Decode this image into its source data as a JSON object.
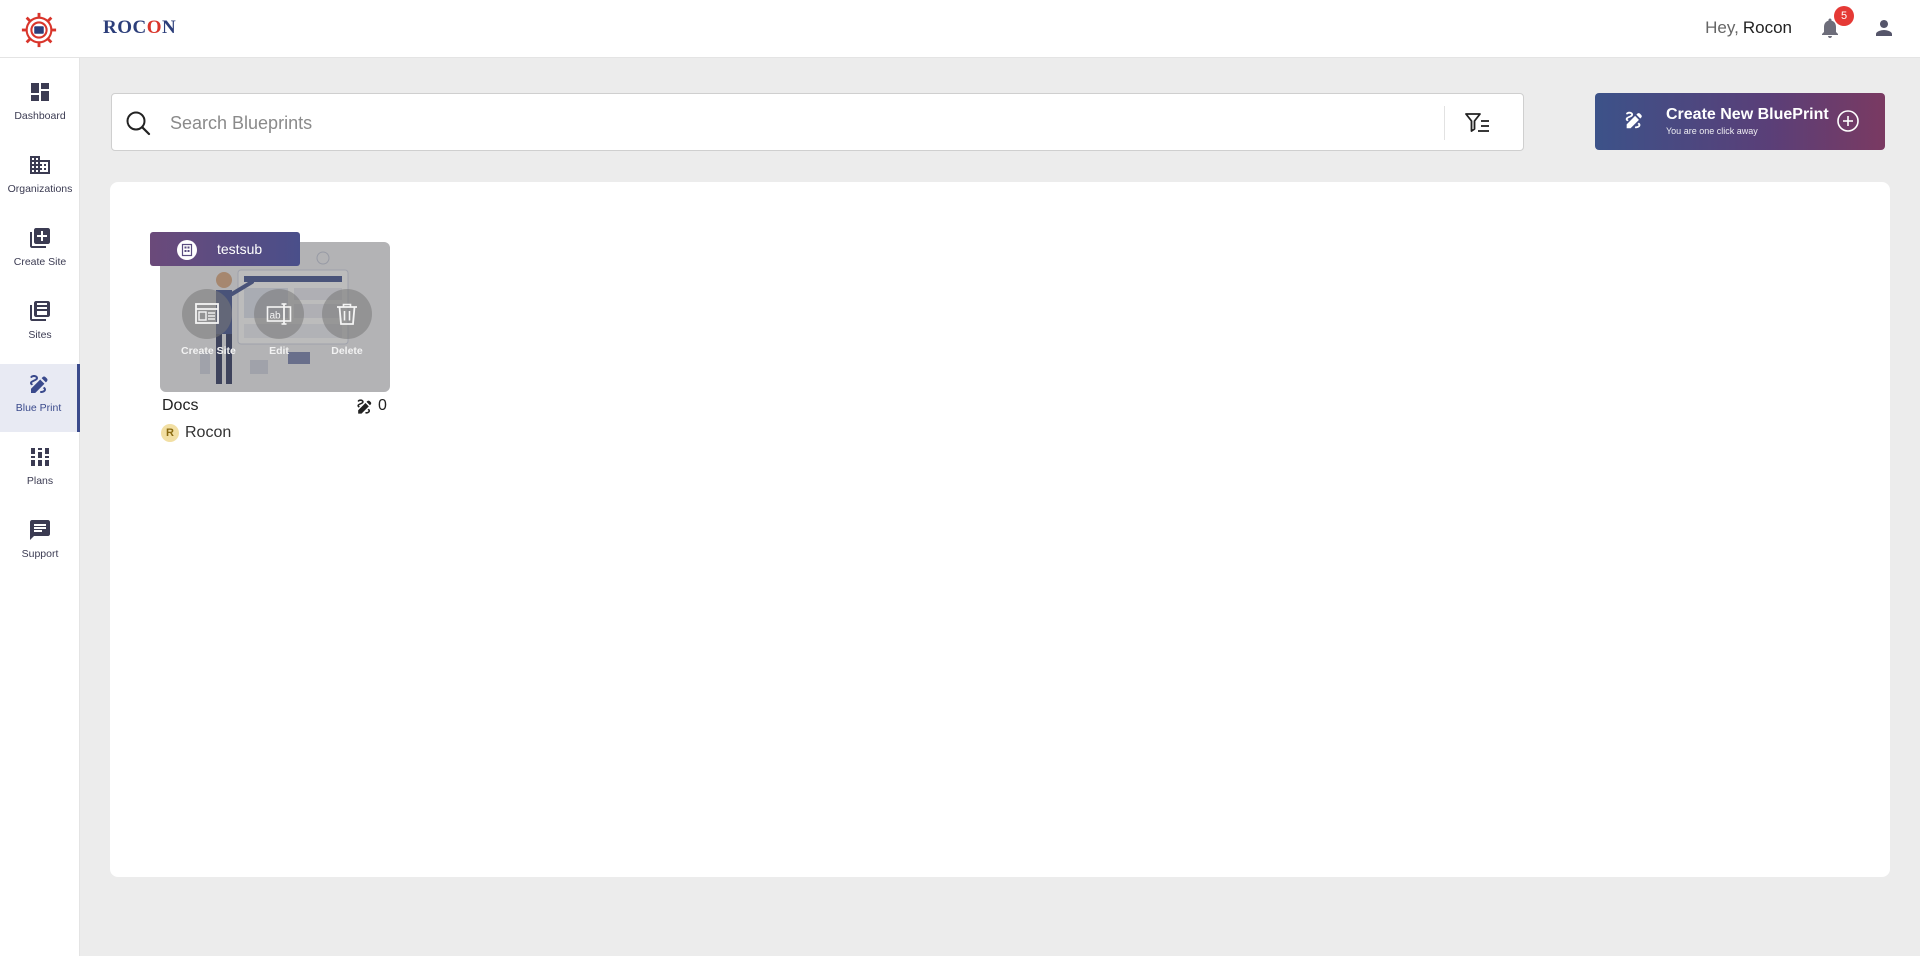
{
  "header": {
    "brand": {
      "prefix": "ROC",
      "accent": "O",
      "suffix": "N"
    },
    "greeting": "Hey,",
    "user_name": "Rocon",
    "notification_count": "5"
  },
  "sidebar": {
    "items": [
      {
        "label": "Dashboard",
        "icon": "dashboard-icon"
      },
      {
        "label": "Organizations",
        "icon": "organizations-icon"
      },
      {
        "label": "Create Site",
        "icon": "add-box-icon"
      },
      {
        "label": "Sites",
        "icon": "sites-icon"
      },
      {
        "label": "Blue Print",
        "icon": "blueprint-icon",
        "active": true
      },
      {
        "label": "Plans",
        "icon": "plans-icon"
      },
      {
        "label": "Support",
        "icon": "support-icon"
      }
    ]
  },
  "search": {
    "placeholder": "Search Blueprints",
    "value": ""
  },
  "create_button": {
    "title": "Create New BluePrint",
    "subtitle": "You are one click away"
  },
  "blueprints": [
    {
      "organization": "testsub",
      "name": "Docs",
      "count": "0",
      "owner": "Rocon",
      "owner_initial": "R",
      "actions": {
        "create_site": "Create Site",
        "edit": "Edit",
        "delete": "Delete"
      }
    }
  ],
  "colors": {
    "accent": "#3a4a8c",
    "gradient_start": "#3c5289",
    "gradient_end": "#7a3a62",
    "badge": "#e53935",
    "brand_red": "#d9352b"
  }
}
